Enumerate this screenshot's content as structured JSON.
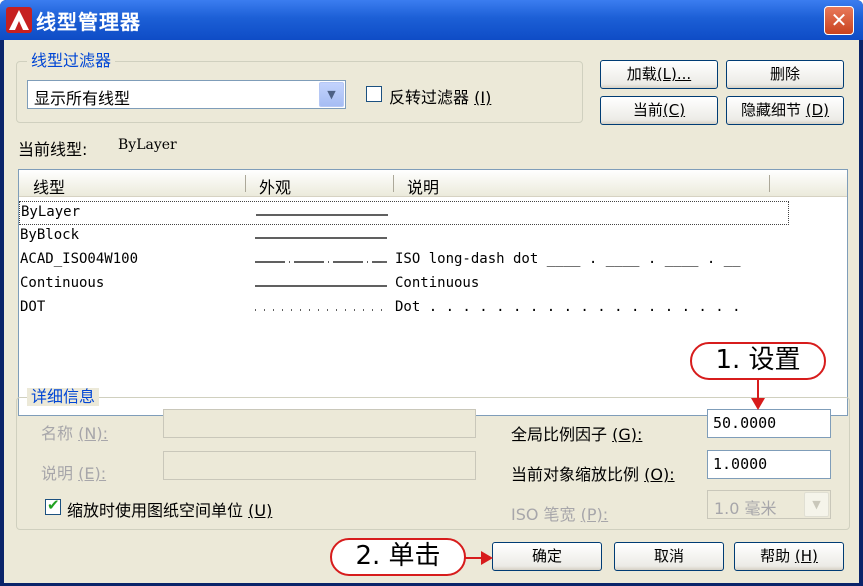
{
  "window": {
    "title": "线型管理器",
    "close": "✕"
  },
  "filter_group": {
    "legend": "线型过滤器",
    "select_value": "显示所有线型",
    "invert_label": "反转过滤器",
    "invert_key": "(I)"
  },
  "buttons": {
    "load": "加载",
    "load_key": "(L)...",
    "delete": "删除",
    "current": "当前",
    "current_key": "(C)",
    "hide_details": "隐藏细节",
    "hide_details_key": "(D)",
    "ok": "确定",
    "cancel": "取消",
    "help": "帮助",
    "help_key": "(H)"
  },
  "current_linetype": {
    "label": "当前线型:",
    "value": "ByLayer"
  },
  "list": {
    "headers": [
      "线型",
      "外观",
      "说明"
    ],
    "rows": [
      {
        "name": "ByLayer",
        "description": ""
      },
      {
        "name": "ByBlock",
        "description": ""
      },
      {
        "name": "ACAD_ISO04W100",
        "description": "ISO long-dash dot ____ . ____ . ____ . __"
      },
      {
        "name": "Continuous",
        "description": "Continuous"
      },
      {
        "name": "DOT",
        "description": "Dot . . . . . . . . . . . . . . . . . . ."
      }
    ]
  },
  "details": {
    "legend": "详细信息",
    "name_label": "名称",
    "name_key": "(N):",
    "desc_label": "说明",
    "desc_key": "(E):",
    "global_scale_label": "全局比例因子",
    "global_scale_key": "(G):",
    "global_scale_value": "50.0000",
    "object_scale_label": "当前对象缩放比例",
    "object_scale_key": "(O):",
    "object_scale_value": "1.0000",
    "paper_space_label": "缩放时使用图纸空间单位",
    "paper_space_key": "(U)",
    "iso_pen_label": "ISO 笔宽",
    "iso_pen_key": "(P):",
    "iso_pen_value": "1.0 毫米"
  },
  "annotations": {
    "step1": "1. 设置",
    "step2": "2. 单击"
  },
  "colors": {
    "title_bar": "#1c5fd6",
    "annotation": "#d71c1c",
    "group_legend": "#0046d5"
  }
}
